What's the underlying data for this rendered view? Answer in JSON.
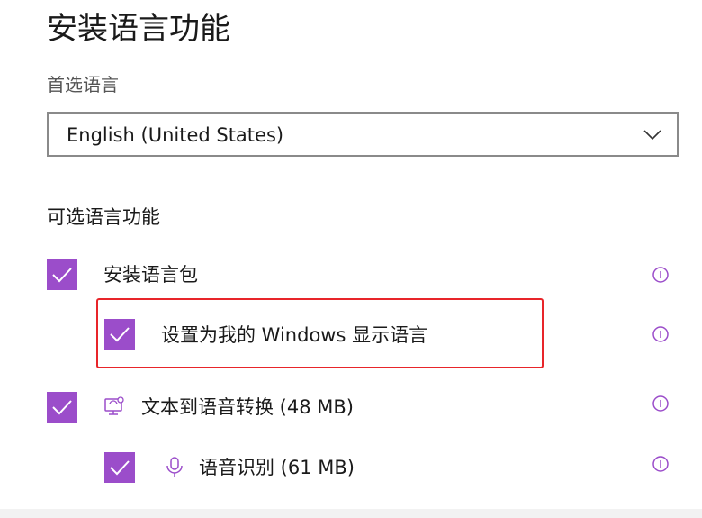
{
  "page": {
    "title": "安装语言功能"
  },
  "preferred_language": {
    "label": "首选语言",
    "selected": "English (United States)"
  },
  "optional_features": {
    "label": "可选语言功能",
    "items": [
      {
        "label": "安装语言包",
        "checked": true,
        "icon": null
      },
      {
        "label": "设置为我的 Windows 显示语言",
        "checked": true,
        "icon": null
      },
      {
        "label": "文本到语音转换 (48 MB)",
        "checked": true,
        "icon": "speech-monitor-icon"
      },
      {
        "label": "语音识别 (61 MB)",
        "checked": true,
        "icon": "microphone-icon"
      }
    ]
  },
  "colors": {
    "accent": "#9b4dca",
    "highlight_border": "#e8252a"
  }
}
